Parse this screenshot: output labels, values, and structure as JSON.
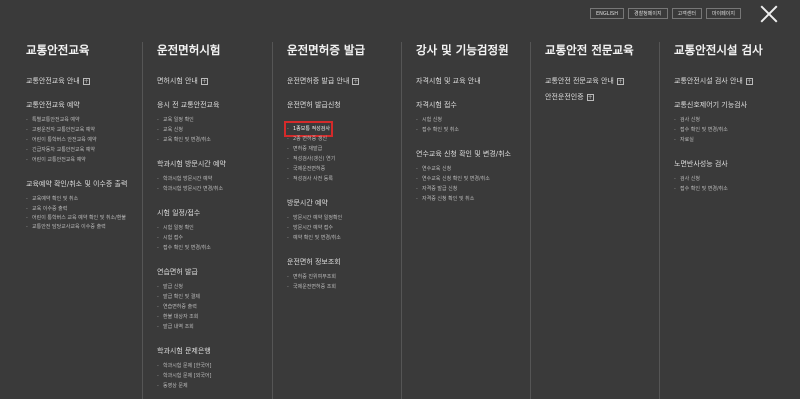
{
  "header": {
    "buttons": [
      "ENGLISH",
      "경찰청페이지",
      "고객센터",
      "마이페이지"
    ]
  },
  "columns": [
    {
      "title": "교통안전교육",
      "sections": [
        {
          "type": "link",
          "label": "교통안전교육 안내"
        },
        {
          "type": "section",
          "label": "교통안전교육 예약",
          "items": [
            "특별교통안전교육 예약",
            "고령운전자 교통안전교육 예약",
            "어린이 통학버스 안전교육 예약",
            "긴급자동차 교통안전교육 예약",
            "어린이 교통안전교육 예약"
          ]
        },
        {
          "type": "section",
          "label": "교육예약 확인/취소 및 이수증 출력",
          "items": [
            "교육예약 확인 및 취소",
            "교육 이수증 출력",
            "어린이 통학버스 교육 예약 확인 및 취소/환불",
            "교통안전 담당교사교육 이수증 출력"
          ]
        }
      ]
    },
    {
      "title": "운전면허시험",
      "sections": [
        {
          "type": "link",
          "label": "면허시험 안내"
        },
        {
          "type": "section",
          "label": "응시 전 교통안전교육",
          "items": [
            "교육 일정 확인",
            "교육 신청",
            "교육 확인 및 변경/취소"
          ]
        },
        {
          "type": "section",
          "label": "학과시험 방문시간 예약",
          "items": [
            "학과시험 방문시간 예약",
            "학과시험 방문시간 변경/취소"
          ]
        },
        {
          "type": "section",
          "label": "시험 일정/접수",
          "items": [
            "시험 일정 확인",
            "시험 접수",
            "접수 확인 및 변경/취소"
          ]
        },
        {
          "type": "section",
          "label": "연습면허 발급",
          "items": [
            "발급 신청",
            "발급 확인 및 결제",
            "연습면허증 출력",
            "환불 대상자 조회",
            "발급 내역 조회"
          ]
        },
        {
          "type": "section",
          "label": "학과시험 문제은행",
          "items": [
            "학과시험 문제 [한국어]",
            "학과시험 문제 [외국어]",
            "동영상 문제"
          ]
        }
      ]
    },
    {
      "title": "운전면허증 발급",
      "sections": [
        {
          "type": "link",
          "label": "운전면허증 발급 안내"
        },
        {
          "type": "section",
          "label": "운전면허 발급신청",
          "items": [
            "1종보통 적성검사",
            "2종 면허증 갱신",
            "면허증 재발급",
            "적성검사(갱신) 연기",
            "국제운전면허증",
            "적성검사 사전 등록"
          ]
        },
        {
          "type": "section",
          "label": "방문시간 예약",
          "items": [
            "방문시간 예약 일정확인",
            "방문시간 예약 접수",
            "예약 확인 및 변경/취소"
          ]
        },
        {
          "type": "section",
          "label": "운전면허 정보조회",
          "items": [
            "면허증 진위여부조회",
            "국제운전면허증 조회"
          ]
        }
      ],
      "highlight_item": "1종보통 적성검사"
    },
    {
      "title": "강사 및 기능검정원",
      "sections": [
        {
          "type": "section-first",
          "label": "자격시험 및 교육 안내"
        },
        {
          "type": "section",
          "label": "자격시험 접수",
          "items": [
            "시험 신청",
            "접수 확인 및 취소"
          ]
        },
        {
          "type": "section",
          "label": "연수교육 신청 확인 및 변경/취소",
          "items": [
            "연수교육 신청",
            "연수교육 신청 확인 및 변경/취소",
            "자격증 발급 신청",
            "자격증 신청 확인 및 취소"
          ]
        }
      ]
    },
    {
      "title": "교통안전 전문교육",
      "sections": [
        {
          "type": "link",
          "label": "교통안전 전문교육 안내"
        },
        {
          "type": "link",
          "label": "안전운전인증"
        }
      ]
    },
    {
      "title": "교통안전시설 검사",
      "sections": [
        {
          "type": "link",
          "label": "교통안전시설 검사 안내"
        },
        {
          "type": "section",
          "label": "교통신호제어기 기능검사",
          "items": [
            "검사 신청",
            "접수 확인 및 변경/취소",
            "자료실"
          ]
        },
        {
          "type": "section",
          "label": "노면반사성능 검사",
          "items": [
            "검사 신청",
            "접수 확인 및 변경/취소"
          ]
        }
      ]
    }
  ]
}
